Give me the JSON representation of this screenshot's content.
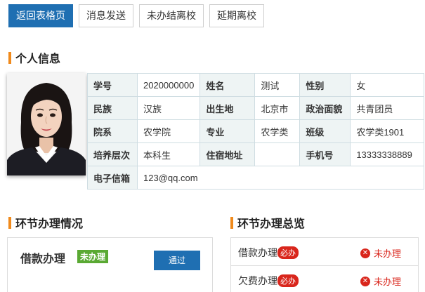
{
  "topbar": {
    "back_label": "返回表格页",
    "message_label": "消息发送",
    "unfinished_label": "未办结离校",
    "delay_label": "延期离校"
  },
  "personal": {
    "title": "个人信息",
    "rows": [
      [
        "学号",
        "2020000000",
        "姓名",
        "测试",
        "性别",
        "女"
      ],
      [
        "民族",
        "汉族",
        "出生地",
        "北京市",
        "政治面貌",
        "共青团员"
      ],
      [
        "院系",
        "农学院",
        "专业",
        "农学类",
        "班级",
        "农学类1901"
      ],
      [
        "培养层次",
        "本科生",
        "住宿地址",
        "",
        "手机号",
        "13333338889"
      ]
    ],
    "email_label": "电子信箱",
    "email_value": "123@qq.com"
  },
  "process": {
    "title": "环节办理情况",
    "step_name": "借款办理",
    "step_status": "未办理",
    "pass_label": "通过"
  },
  "overview": {
    "title": "环节办理总览",
    "items": [
      {
        "name": "借款办理",
        "tag": "必办",
        "status": "未办理"
      },
      {
        "name": "欠费办理",
        "tag": "必办",
        "status": "未办理"
      }
    ]
  },
  "colors": {
    "primary": "#1f6fb2",
    "accent_bar": "#f08a1c",
    "status_green": "#5aa933",
    "status_red": "#d9261c"
  }
}
